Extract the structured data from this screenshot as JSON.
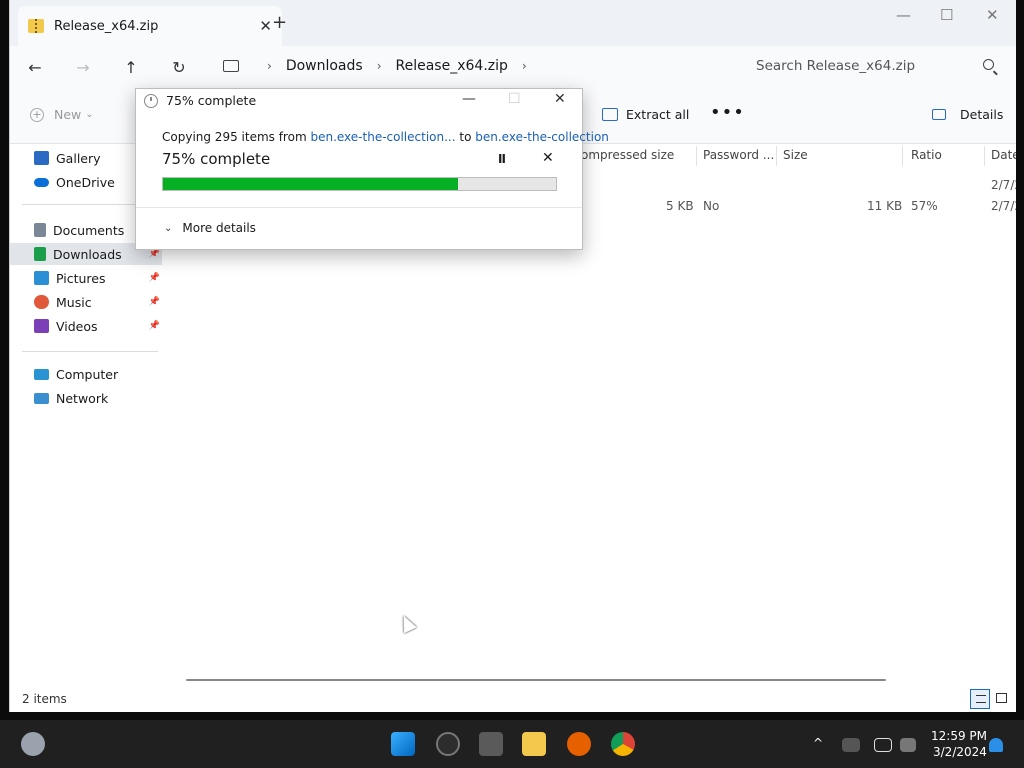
{
  "window": {
    "tab_title": "Release_x64.zip",
    "tab_close": "✕",
    "new_tab": "+",
    "minimize": "—",
    "maximize": "☐",
    "close": "✕"
  },
  "nav": {
    "back": "←",
    "forward": "→",
    "up": "↑",
    "refresh": "↻",
    "chevron": "›",
    "breadcrumbs": [
      "Downloads",
      "Release_x64.zip"
    ],
    "search_placeholder": "Search Release_x64.zip"
  },
  "commandbar": {
    "new_label": "New",
    "new_caret": "⌄",
    "extract_label": "Extract all",
    "more_label": "•••",
    "details_label": "Details"
  },
  "sidebar": {
    "items": [
      {
        "label": "Gallery",
        "color": "#2b6ac2"
      },
      {
        "label": "OneDrive",
        "color": "#0a6fd6"
      },
      {
        "label": "Documents",
        "color": "#7a8797"
      },
      {
        "label": "Downloads",
        "color": "#1a9e4a"
      },
      {
        "label": "Pictures",
        "color": "#2b8fd6"
      },
      {
        "label": "Music",
        "color": "#e0593a"
      },
      {
        "label": "Videos",
        "color": "#7b3fb8"
      },
      {
        "label": "Computer",
        "color": "#2a93d1"
      },
      {
        "label": "Network",
        "color": "#3a8fd0"
      }
    ],
    "pin": "📌"
  },
  "columns": [
    "ompressed size",
    "Password ...",
    "Size",
    "Ratio",
    "Date"
  ],
  "rows": [
    {
      "compressed": "",
      "password": "",
      "size": "",
      "ratio": "",
      "date": "2/7/2"
    },
    {
      "compressed": "5 KB",
      "password": "No",
      "size": "11 KB",
      "ratio": "57%",
      "date": "2/7/2"
    }
  ],
  "status": {
    "items": "2 items"
  },
  "dialog": {
    "title": "75% complete",
    "copy_prefix": "Copying 295 items from",
    "source": "ben.exe-the-collection...",
    "to": "to",
    "dest": "ben.exe-the-collection",
    "percent_label": "75% complete",
    "progress": 0.75,
    "pause": "II",
    "cancel": "✕",
    "more_details": "More details",
    "more_chevron": "⌄",
    "minimize": "—",
    "maximize": "☐",
    "close": "✕",
    "accent": "#06b025"
  },
  "taskbar": {
    "time": "12:59 PM",
    "date": "3/2/2024",
    "tray_up": "^"
  }
}
